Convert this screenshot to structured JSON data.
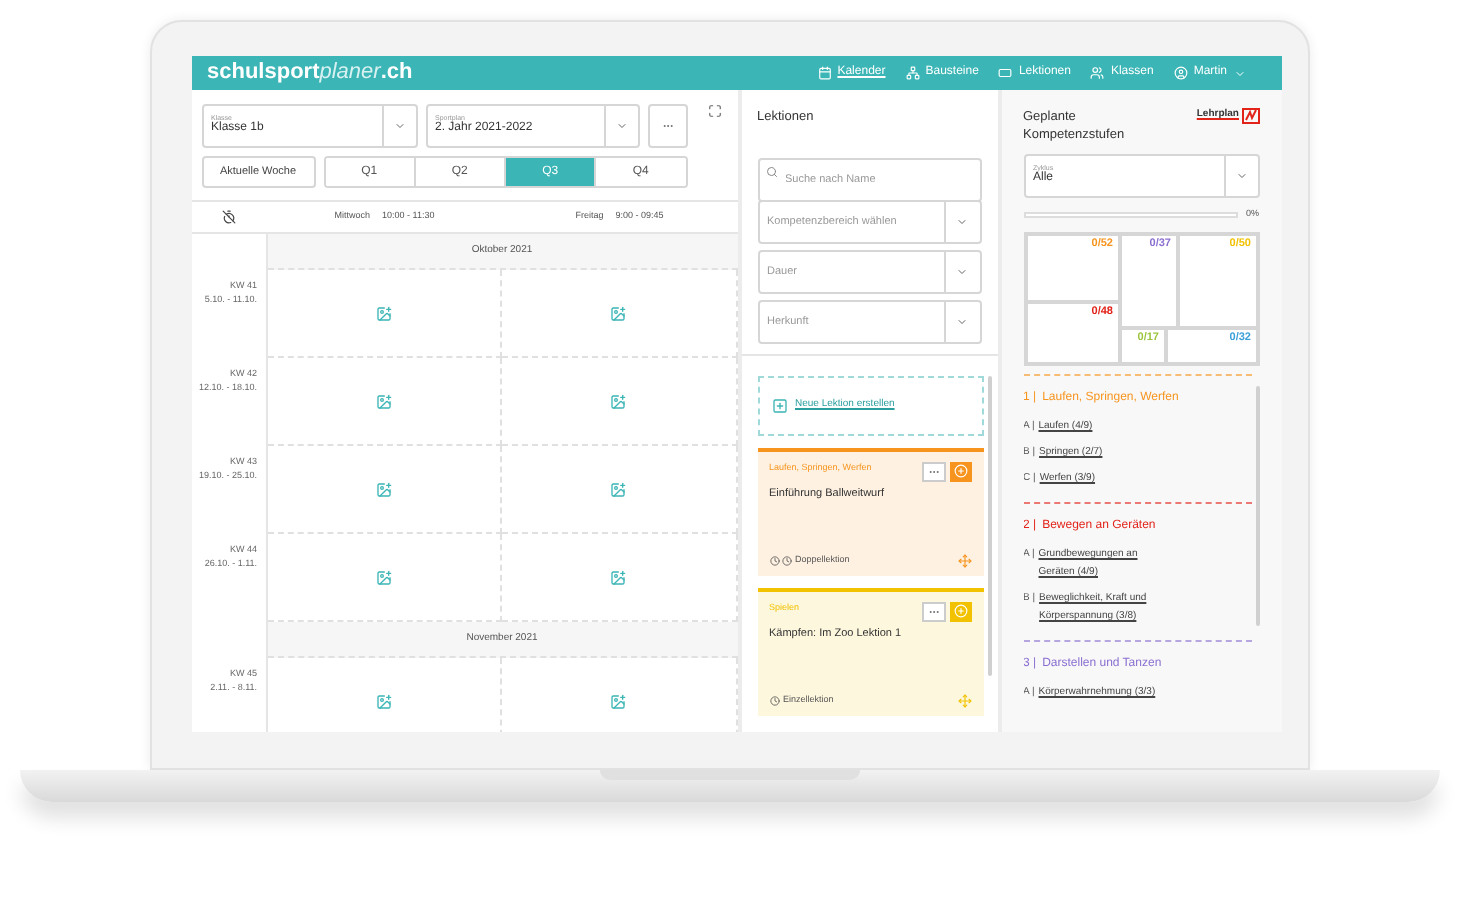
{
  "header": {
    "logo": {
      "bold": "schulsport",
      "light": "planer",
      "suffix": ".ch"
    },
    "nav": [
      {
        "label": "Kalender",
        "selected": true
      },
      {
        "label": "Bausteine",
        "selected": false
      },
      {
        "label": "Lektionen",
        "selected": false
      },
      {
        "label": "Klassen",
        "selected": false
      }
    ],
    "user": "Martin"
  },
  "calendar": {
    "class_select": {
      "label": "Klasse",
      "value": "Klasse 1b"
    },
    "plan_select": {
      "label": "Sportplan",
      "value": "2. Jahr 2021-2022"
    },
    "today_button": "Aktuelle Woche",
    "quarters": [
      {
        "label": "Q1",
        "selected": false
      },
      {
        "label": "Q2",
        "selected": false
      },
      {
        "label": "Q3",
        "selected": true
      },
      {
        "label": "Q4",
        "selected": false
      }
    ],
    "slots": [
      {
        "day": "Mittwoch",
        "time": "10:00 - 11:30"
      },
      {
        "day": "Freitag",
        "time": "9:00 - 09:45"
      }
    ],
    "rows": [
      {
        "kind": "month",
        "label": "Oktober 2021"
      },
      {
        "kind": "week",
        "week": "KW 41",
        "dates": "5.10. - 11.10."
      },
      {
        "kind": "week",
        "week": "KW 42",
        "dates": "12.10. - 18.10."
      },
      {
        "kind": "week",
        "week": "KW 43",
        "dates": "19.10. - 25.10."
      },
      {
        "kind": "week",
        "week": "KW 44",
        "dates": "26.10. - 1.11."
      },
      {
        "kind": "month",
        "label": "November 2021"
      },
      {
        "kind": "week",
        "week": "KW 45",
        "dates": "2.11. - 8.11."
      }
    ]
  },
  "lessons": {
    "title": "Lektionen",
    "search": {
      "placeholder": "Suche nach Name"
    },
    "filters": [
      {
        "placeholder": "Kompetenzbereich wählen"
      },
      {
        "placeholder": "Dauer"
      },
      {
        "placeholder": "Herkunft"
      }
    ],
    "new_lesson": "Neue Lektion erstellen",
    "cards": [
      {
        "category": "Laufen, Springen, Werfen",
        "title": "Einführung Ballweitwurf",
        "duration": "Doppellektion",
        "kind": "double",
        "color": "#f7941d"
      },
      {
        "category": "Spielen",
        "title": "Kämpfen: Im Zoo Lektion 1",
        "duration": "Einzellektion",
        "kind": "single",
        "color": "#f2c200"
      }
    ]
  },
  "competences": {
    "title": "Geplante Kompetenzstufen",
    "logo": "Lehrplan",
    "zyklus": {
      "label": "Zyklus",
      "value": "Alle"
    },
    "progress": {
      "level": 0,
      "reading": "0%"
    },
    "tiles": [
      {
        "label": "0/52",
        "color": "#f7941d"
      },
      {
        "label": "0/48",
        "color": "#e2231a"
      },
      {
        "label": "0/37",
        "color": "#8a6fd1"
      },
      {
        "label": "0/50",
        "color": "#f2c200"
      },
      {
        "label": "0/17",
        "color": "#9bc53d"
      },
      {
        "label": "0/32",
        "color": "#3aa0d8"
      }
    ],
    "sections": [
      {
        "prefix": "1 |",
        "title": "Laufen, Springen, Werfen",
        "color": "#f7941d",
        "items": [
          {
            "letter": "A |",
            "label": "Laufen (4/9)"
          },
          {
            "letter": "B |",
            "label": "Springen (2/7)"
          },
          {
            "letter": "C |",
            "label": "Werfen (3/9)"
          }
        ]
      },
      {
        "prefix": "2 |",
        "title": "Bewegen an Geräten",
        "color": "#e2231a",
        "items": [
          {
            "letter": "A |",
            "label": "Grundbewegungen an Geräten (4/9)"
          },
          {
            "letter": "B |",
            "label": "Beweglichkeit, Kraft und Körperspannung (3/8)"
          }
        ]
      },
      {
        "prefix": "3 |",
        "title": "Darstellen und Tanzen",
        "color": "#8a6fd1",
        "items": [
          {
            "letter": "A |",
            "label": "Körperwahrnehmung (3/3)"
          }
        ]
      }
    ]
  }
}
